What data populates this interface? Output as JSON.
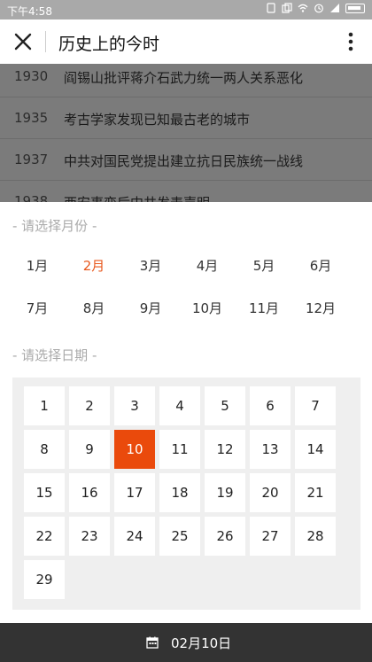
{
  "status_bar": {
    "time": "下午4:58"
  },
  "header": {
    "title": "历史上的今时"
  },
  "events": [
    {
      "year": "1930",
      "title": "阎锡山批评蒋介石武力统一两人关系恶化"
    },
    {
      "year": "1935",
      "title": "考古学家发现已知最古老的城市"
    },
    {
      "year": "1937",
      "title": "中共对国民党提出建立抗日民族统一战线"
    },
    {
      "year": "1938",
      "title": "西安事变后中共发表声明"
    }
  ],
  "picker": {
    "month_label": "- 请选择月份 -",
    "day_label": "- 请选择日期 -",
    "months": [
      "1月",
      "2月",
      "3月",
      "4月",
      "5月",
      "6月",
      "7月",
      "8月",
      "9月",
      "10月",
      "11月",
      "12月"
    ],
    "selected_month": "2月",
    "days": [
      "1",
      "2",
      "3",
      "4",
      "5",
      "6",
      "7",
      "8",
      "9",
      "10",
      "11",
      "12",
      "13",
      "14",
      "15",
      "16",
      "17",
      "18",
      "19",
      "20",
      "21",
      "22",
      "23",
      "24",
      "25",
      "26",
      "27",
      "28",
      "29"
    ],
    "selected_day": "10"
  },
  "footer": {
    "date": "02月10日"
  },
  "colors": {
    "accent": "#ea4a0c",
    "month_active": "#e8581d",
    "footer_bg": "#333333"
  }
}
